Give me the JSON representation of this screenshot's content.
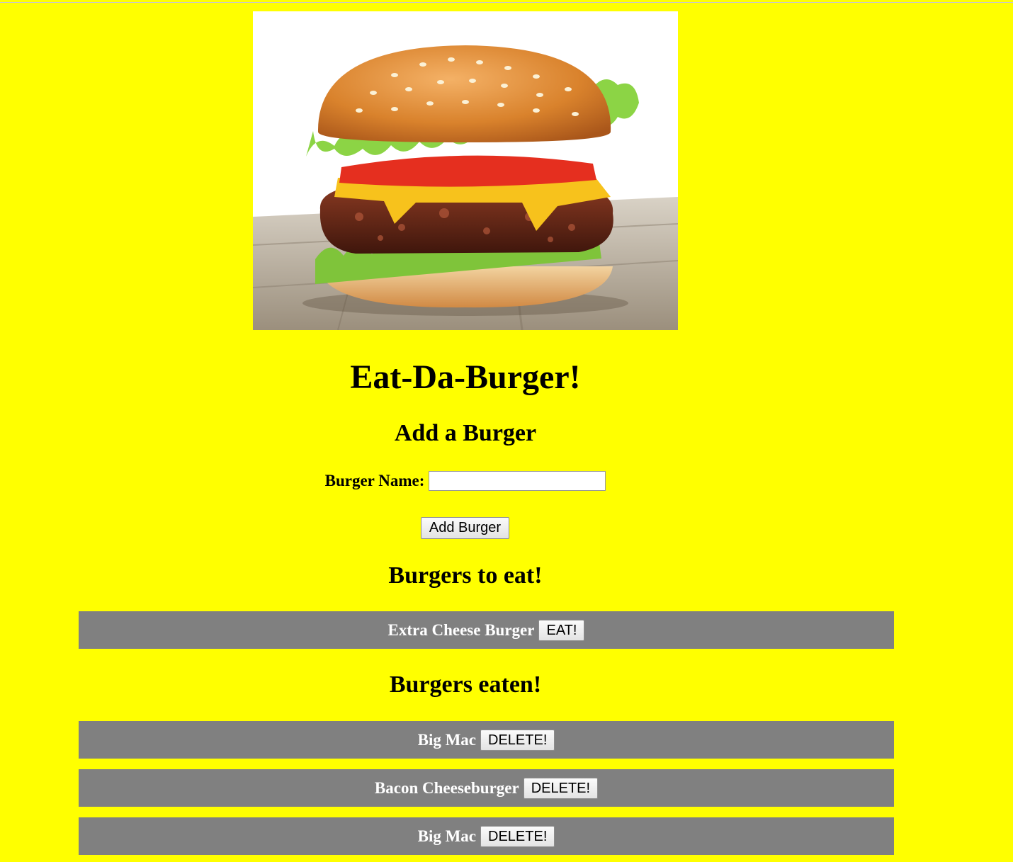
{
  "page": {
    "title": "Eat-Da-Burger!",
    "hero_image": "burger-photo",
    "background_color": "#ffff00"
  },
  "form": {
    "heading": "Add a Burger",
    "label": "Burger Name:",
    "input_value": "",
    "submit_label": "Add Burger"
  },
  "to_eat": {
    "heading": "Burgers to eat!",
    "items": [
      {
        "name": "Extra Cheese Burger",
        "action": "EAT!"
      }
    ]
  },
  "eaten": {
    "heading": "Burgers eaten!",
    "items": [
      {
        "name": "Big Mac",
        "action": "DELETE!"
      },
      {
        "name": "Bacon Cheeseburger",
        "action": "DELETE!"
      },
      {
        "name": "Big Mac",
        "action": "DELETE!"
      }
    ]
  },
  "colors": {
    "page_bg": "#ffff00",
    "row_bg": "#808080",
    "row_text": "#ffffff"
  }
}
